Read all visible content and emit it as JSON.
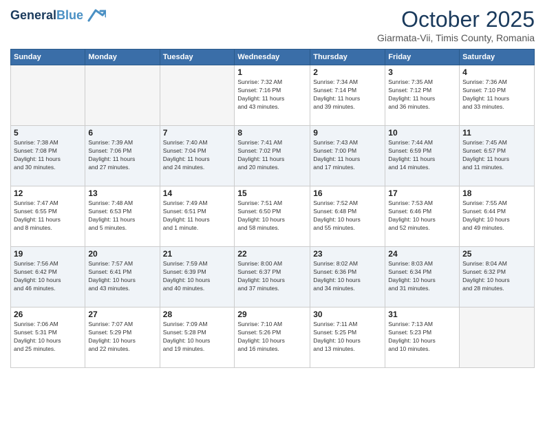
{
  "header": {
    "logo_line1": "General",
    "logo_line2": "Blue",
    "month": "October 2025",
    "location": "Giarmata-Vii, Timis County, Romania"
  },
  "weekdays": [
    "Sunday",
    "Monday",
    "Tuesday",
    "Wednesday",
    "Thursday",
    "Friday",
    "Saturday"
  ],
  "weeks": [
    [
      {
        "day": "",
        "info": ""
      },
      {
        "day": "",
        "info": ""
      },
      {
        "day": "",
        "info": ""
      },
      {
        "day": "1",
        "info": "Sunrise: 7:32 AM\nSunset: 7:16 PM\nDaylight: 11 hours\nand 43 minutes."
      },
      {
        "day": "2",
        "info": "Sunrise: 7:34 AM\nSunset: 7:14 PM\nDaylight: 11 hours\nand 39 minutes."
      },
      {
        "day": "3",
        "info": "Sunrise: 7:35 AM\nSunset: 7:12 PM\nDaylight: 11 hours\nand 36 minutes."
      },
      {
        "day": "4",
        "info": "Sunrise: 7:36 AM\nSunset: 7:10 PM\nDaylight: 11 hours\nand 33 minutes."
      }
    ],
    [
      {
        "day": "5",
        "info": "Sunrise: 7:38 AM\nSunset: 7:08 PM\nDaylight: 11 hours\nand 30 minutes."
      },
      {
        "day": "6",
        "info": "Sunrise: 7:39 AM\nSunset: 7:06 PM\nDaylight: 11 hours\nand 27 minutes."
      },
      {
        "day": "7",
        "info": "Sunrise: 7:40 AM\nSunset: 7:04 PM\nDaylight: 11 hours\nand 24 minutes."
      },
      {
        "day": "8",
        "info": "Sunrise: 7:41 AM\nSunset: 7:02 PM\nDaylight: 11 hours\nand 20 minutes."
      },
      {
        "day": "9",
        "info": "Sunrise: 7:43 AM\nSunset: 7:00 PM\nDaylight: 11 hours\nand 17 minutes."
      },
      {
        "day": "10",
        "info": "Sunrise: 7:44 AM\nSunset: 6:59 PM\nDaylight: 11 hours\nand 14 minutes."
      },
      {
        "day": "11",
        "info": "Sunrise: 7:45 AM\nSunset: 6:57 PM\nDaylight: 11 hours\nand 11 minutes."
      }
    ],
    [
      {
        "day": "12",
        "info": "Sunrise: 7:47 AM\nSunset: 6:55 PM\nDaylight: 11 hours\nand 8 minutes."
      },
      {
        "day": "13",
        "info": "Sunrise: 7:48 AM\nSunset: 6:53 PM\nDaylight: 11 hours\nand 5 minutes."
      },
      {
        "day": "14",
        "info": "Sunrise: 7:49 AM\nSunset: 6:51 PM\nDaylight: 11 hours\nand 1 minute."
      },
      {
        "day": "15",
        "info": "Sunrise: 7:51 AM\nSunset: 6:50 PM\nDaylight: 10 hours\nand 58 minutes."
      },
      {
        "day": "16",
        "info": "Sunrise: 7:52 AM\nSunset: 6:48 PM\nDaylight: 10 hours\nand 55 minutes."
      },
      {
        "day": "17",
        "info": "Sunrise: 7:53 AM\nSunset: 6:46 PM\nDaylight: 10 hours\nand 52 minutes."
      },
      {
        "day": "18",
        "info": "Sunrise: 7:55 AM\nSunset: 6:44 PM\nDaylight: 10 hours\nand 49 minutes."
      }
    ],
    [
      {
        "day": "19",
        "info": "Sunrise: 7:56 AM\nSunset: 6:42 PM\nDaylight: 10 hours\nand 46 minutes."
      },
      {
        "day": "20",
        "info": "Sunrise: 7:57 AM\nSunset: 6:41 PM\nDaylight: 10 hours\nand 43 minutes."
      },
      {
        "day": "21",
        "info": "Sunrise: 7:59 AM\nSunset: 6:39 PM\nDaylight: 10 hours\nand 40 minutes."
      },
      {
        "day": "22",
        "info": "Sunrise: 8:00 AM\nSunset: 6:37 PM\nDaylight: 10 hours\nand 37 minutes."
      },
      {
        "day": "23",
        "info": "Sunrise: 8:02 AM\nSunset: 6:36 PM\nDaylight: 10 hours\nand 34 minutes."
      },
      {
        "day": "24",
        "info": "Sunrise: 8:03 AM\nSunset: 6:34 PM\nDaylight: 10 hours\nand 31 minutes."
      },
      {
        "day": "25",
        "info": "Sunrise: 8:04 AM\nSunset: 6:32 PM\nDaylight: 10 hours\nand 28 minutes."
      }
    ],
    [
      {
        "day": "26",
        "info": "Sunrise: 7:06 AM\nSunset: 5:31 PM\nDaylight: 10 hours\nand 25 minutes."
      },
      {
        "day": "27",
        "info": "Sunrise: 7:07 AM\nSunset: 5:29 PM\nDaylight: 10 hours\nand 22 minutes."
      },
      {
        "day": "28",
        "info": "Sunrise: 7:09 AM\nSunset: 5:28 PM\nDaylight: 10 hours\nand 19 minutes."
      },
      {
        "day": "29",
        "info": "Sunrise: 7:10 AM\nSunset: 5:26 PM\nDaylight: 10 hours\nand 16 minutes."
      },
      {
        "day": "30",
        "info": "Sunrise: 7:11 AM\nSunset: 5:25 PM\nDaylight: 10 hours\nand 13 minutes."
      },
      {
        "day": "31",
        "info": "Sunrise: 7:13 AM\nSunset: 5:23 PM\nDaylight: 10 hours\nand 10 minutes."
      },
      {
        "day": "",
        "info": ""
      }
    ]
  ]
}
